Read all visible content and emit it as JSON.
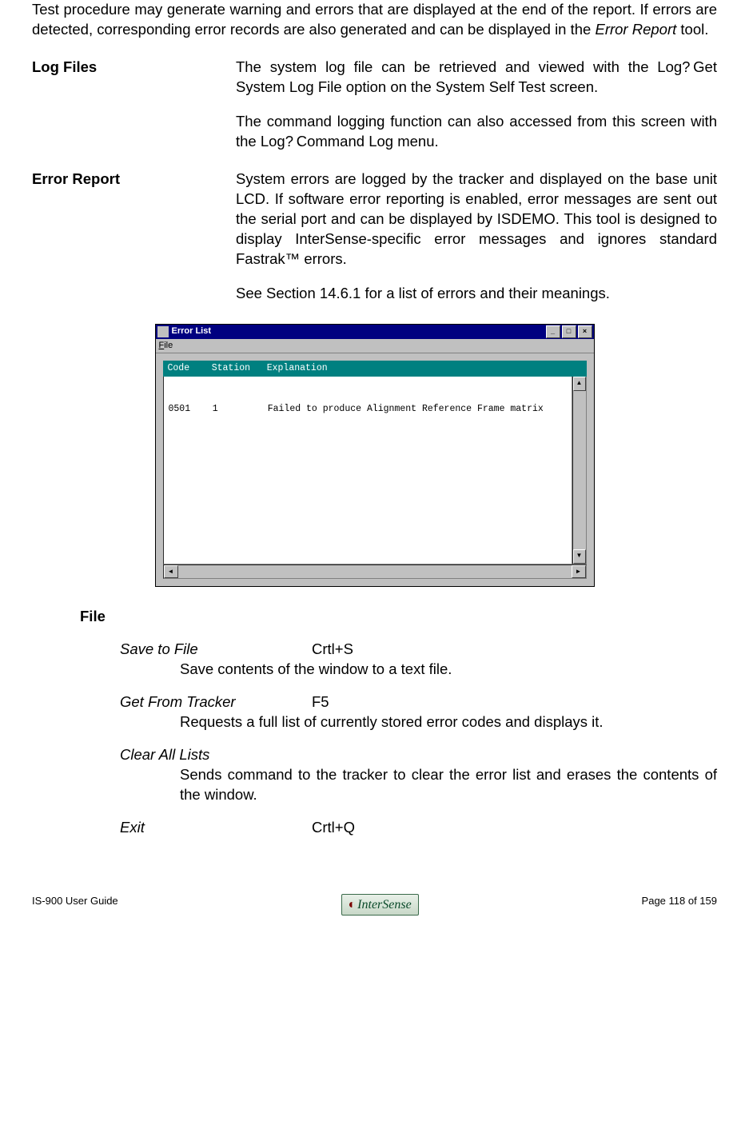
{
  "intro": {
    "p1a": "Test procedure may generate warning and errors that are displayed at the end of the report.  If errors are detected, corresponding error records are also generated and can be displayed in the ",
    "p1_italic": "Error Report",
    "p1b": " tool."
  },
  "sections": {
    "logfiles": {
      "label": "Log Files",
      "p1": "The system log file can be retrieved and viewed with the Log? Get System Log File option on the System Self Test screen.",
      "p2": "The command logging function can also accessed from this screen with the Log? Command Log menu."
    },
    "errorreport": {
      "label": "Error Report",
      "p1": "System errors are logged by the tracker and displayed on the base unit LCD.  If software error reporting is enabled, error messages are sent out the serial port and can be displayed by ISDEMO.  This tool is designed to display InterSense-specific error messages and ignores standard Fastrak™ errors.",
      "p2": "See Section 14.6.1 for a list of errors and their meanings."
    }
  },
  "window": {
    "title": "Error List",
    "menu_file_letter": "F",
    "menu_file_rest": "ile",
    "list_header": "Code    Station   Explanation",
    "list_row1": "0501    1         Failed to produce Alignment Reference Frame matrix",
    "min": "_",
    "max": "□",
    "close": "×",
    "up": "▲",
    "down": "▼",
    "left": "◄",
    "right": "►"
  },
  "filemenu": {
    "title": "File",
    "items": [
      {
        "name": "Save to File",
        "shortcut": "Crtl+S",
        "desc": "Save contents of the window to a text file."
      },
      {
        "name": "Get From Tracker",
        "shortcut": "F5",
        "desc": "Requests a full list of currently stored error codes and displays it."
      },
      {
        "name": "Clear All Lists",
        "shortcut": "",
        "desc": "Sends command to the tracker to clear the error list and erases the contents of the window."
      },
      {
        "name": "Exit",
        "shortcut": "Crtl+Q",
        "desc": ""
      }
    ]
  },
  "footer": {
    "left": "IS-900 User Guide",
    "right": "Page 118 of 159",
    "logo_text": "InterSense"
  }
}
